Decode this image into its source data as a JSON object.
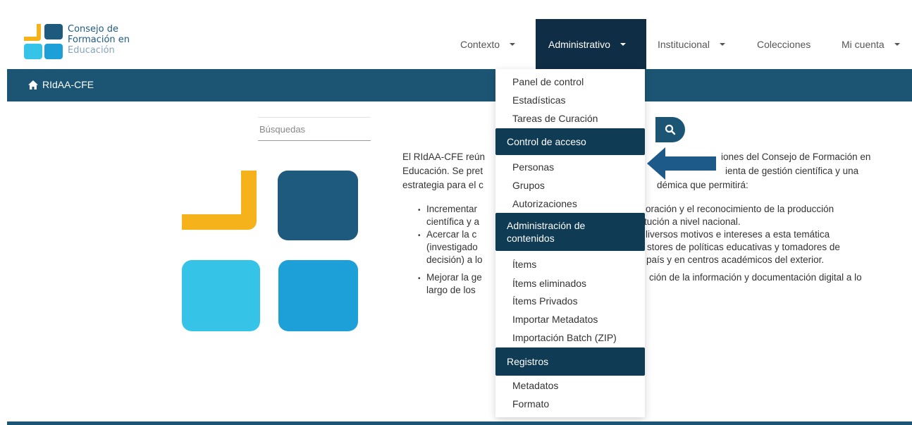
{
  "brand": {
    "line1": "Consejo de",
    "line2": "Formación en",
    "line3": "Educación"
  },
  "nav": {
    "items": [
      {
        "label": "Contexto",
        "has_caret": true
      },
      {
        "label": "Administrativo",
        "has_caret": true,
        "active": true
      },
      {
        "label": "Institucional",
        "has_caret": true
      },
      {
        "label": "Colecciones",
        "has_caret": false
      },
      {
        "label": "Mi cuenta",
        "has_caret": true
      }
    ]
  },
  "breadcrumb": {
    "icon": "home-icon",
    "label": "RIdAA-CFE"
  },
  "search": {
    "placeholder": "Búsquedas",
    "button_icon": "search-icon"
  },
  "dropdown": {
    "panel": "Panel de control",
    "stats": "Estadísticas",
    "curation": "Tareas de Curación",
    "access_header": "Control de acceso",
    "people": "Personas",
    "groups": "Grupos",
    "auth": "Autorizaciones",
    "content_header_line1": "Administración de",
    "content_header_line2": "contenidos",
    "items": "Ítems",
    "deleted": "Ítems eliminados",
    "private": "Ítems Privados",
    "import_meta": "Importar Metadatos",
    "import_batch": "Importación Batch (ZIP)",
    "registry_header": "Registros",
    "metadata": "Metadatos",
    "format": "Formato"
  },
  "content": {
    "intro_line1_a": "El RIdAA-CFE reún",
    "intro_line1_b": "iones del Consejo de Formación en",
    "intro_line2_a": "Educación. Se pret",
    "intro_line2_b": "ienta de gestión científica y una",
    "intro_line3_a": "estrategia para el c",
    "intro_line3_b": "démica que permitirá:",
    "b1_l1_a": "Incrementar",
    "b1_l1_b": "oración y el reconocimiento de la producción",
    "b1_l2_a": "científica y a",
    "b1_l2_b": "tución a nivel nacional.",
    "b2_l1_a": "Acercar la c",
    "b2_l1_b": "liversos motivos e intereses a esta temática",
    "b2_l2_a": "(investigado",
    "b2_l2_b": "stores de políticas educativas y tomadores de",
    "b2_l3_a": "decisión) a lo",
    "b2_l3_b": "país y en centros académicos del exterior.",
    "b3_l1_a": "Mejorar la ge",
    "b3_l1_b": "ción de la información y documentación digital a lo",
    "b3_l2_a": "largo de los"
  },
  "colors": {
    "primary_dark": "#0f3b55",
    "bar": "#1b5573",
    "logo_yellow": "#f6b21b",
    "logo_navy": "#1d5a7e",
    "logo_cyan": "#35c4e8",
    "logo_blue": "#1da0d8",
    "arrow": "#1d5a8a"
  }
}
